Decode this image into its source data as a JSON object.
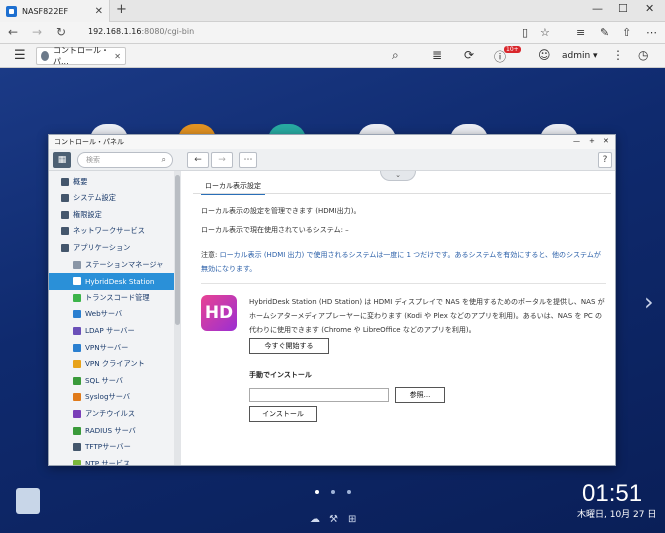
{
  "browser": {
    "tab_title": "NASF822EF",
    "new_tab": "+",
    "url_host": "192.168.1.16",
    "url_rest": ":8080/cgi-bin"
  },
  "qts": {
    "tab_label": "コントロール・パ...",
    "notif_badge": "10+",
    "user": "admin ▾"
  },
  "panel": {
    "title": "コントロール・パネル",
    "search_placeholder": "検索",
    "help": "?",
    "sidebar": [
      {
        "label": "概要",
        "icon_color": "#44566c",
        "indent": false
      },
      {
        "label": "システム設定",
        "icon_color": "#44566c",
        "indent": false
      },
      {
        "label": "権限設定",
        "icon_color": "#44566c",
        "indent": false
      },
      {
        "label": "ネットワークサービス",
        "icon_color": "#44566c",
        "indent": false
      },
      {
        "label": "アプリケーション",
        "icon_color": "#44566c",
        "indent": false
      },
      {
        "label": "ステーションマネージャ",
        "icon_color": "#8a96a6",
        "indent": true
      },
      {
        "label": "HybridDesk Station",
        "icon_color": "#c63fb8",
        "indent": true
      },
      {
        "label": "トランスコード管理",
        "icon_color": "#3cb44a",
        "indent": true
      },
      {
        "label": "Webサーバ",
        "icon_color": "#2a7fd0",
        "indent": true
      },
      {
        "label": "LDAP サーバー",
        "icon_color": "#6a4fb8",
        "indent": true
      },
      {
        "label": "VPNサーバー",
        "icon_color": "#2a7fd0",
        "indent": true
      },
      {
        "label": "VPN クライアント",
        "icon_color": "#e7a21a",
        "indent": true
      },
      {
        "label": "SQL サーバ",
        "icon_color": "#3a9a3a",
        "indent": true
      },
      {
        "label": "Syslogサーバ",
        "icon_color": "#e07a1a",
        "indent": true
      },
      {
        "label": "アンチウイルス",
        "icon_color": "#7a3fb8",
        "indent": true
      },
      {
        "label": "RADIUS サーバ",
        "icon_color": "#3a9a3a",
        "indent": true
      },
      {
        "label": "TFTPサーバー",
        "icon_color": "#44566c",
        "indent": true
      },
      {
        "label": "NTP サービス",
        "icon_color": "#7ab83a",
        "indent": true
      }
    ],
    "selected_index": 6,
    "main": {
      "tab": "ローカル表示設定",
      "line1": "ローカル表示の設定を管理できます (HDMI出力)。",
      "line2": "ローカル表示で現在使用されているシステム:  –",
      "note_label": "注意:",
      "note": "ローカル表示 (HDMI 出力) で使用されるシステムは一度に 1 つだけです。あるシステムを有効にすると、他のシステムが無効になります。",
      "hd_logo": "HD",
      "hd_description": "HybridDesk Station (HD Station) は HDMI ディスプレイで NAS を使用するためのポータルを提供し、NAS がホームシアターメディアプレーヤーに変わります (Kodi や Plex などのアプリを利用)。あるいは、NAS を PC の代わりに使用できます (Chrome や LibreOffice などのアプリを利用)。",
      "start_button": "今すぐ開始する",
      "manual_label": "手動でインストール",
      "browse_button": "参照...",
      "install_button": "インストール"
    }
  },
  "desktop": {
    "time": "01:51",
    "date": "木曜日, 10月 27 日"
  }
}
